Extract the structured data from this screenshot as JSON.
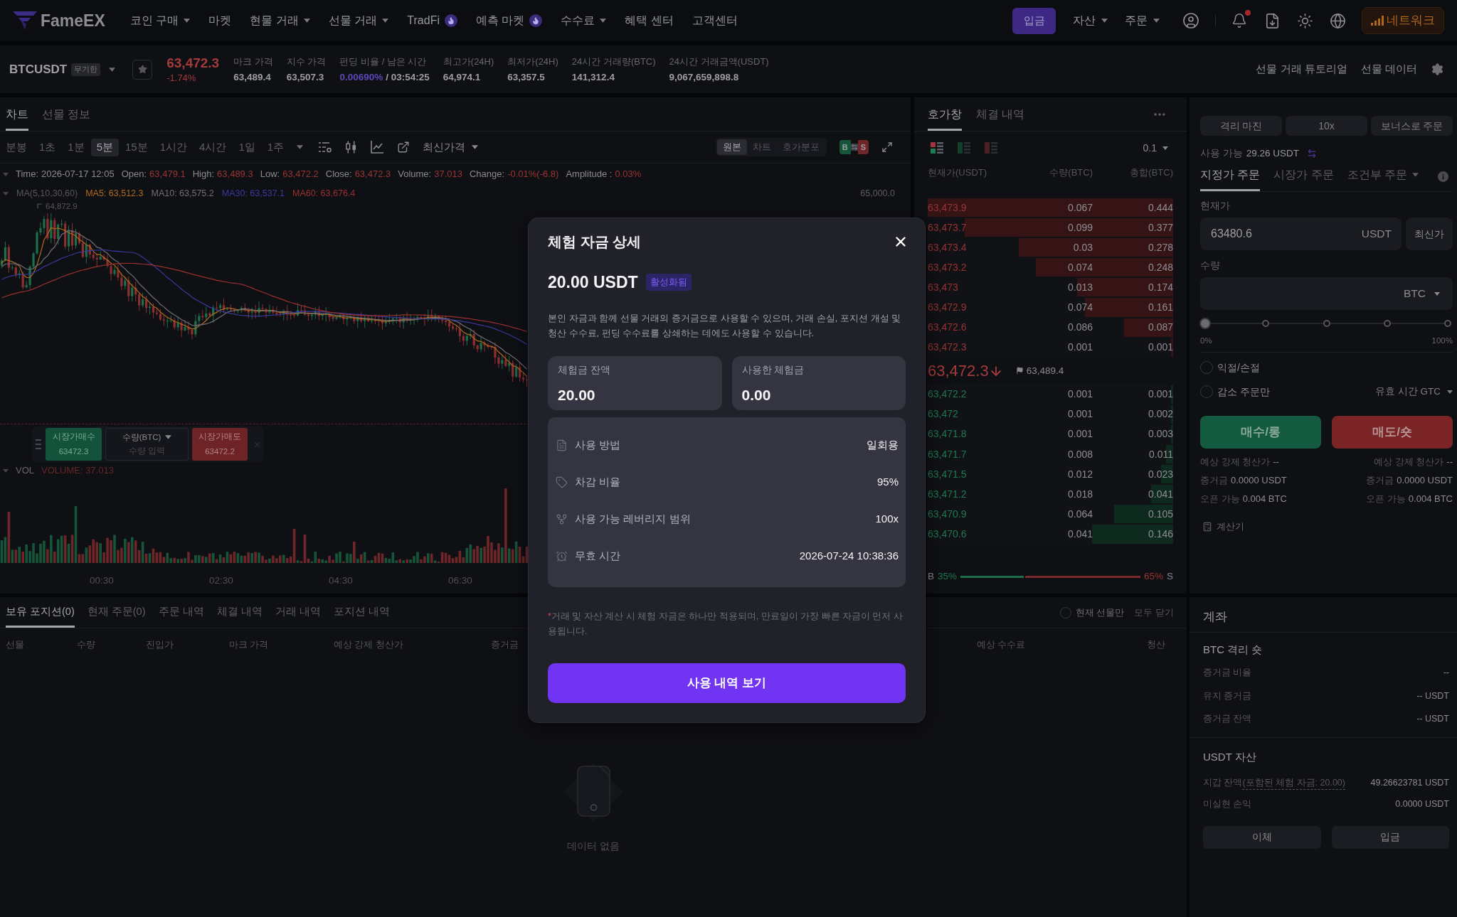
{
  "nav": {
    "logo": "FameEX",
    "items": [
      {
        "label": "코인 구매",
        "kind": "menu"
      },
      {
        "label": "마켓",
        "kind": "link"
      },
      {
        "label": "현물 거래",
        "kind": "menu"
      },
      {
        "label": "선물 거래",
        "kind": "menu"
      },
      {
        "label": "TradFi",
        "kind": "hot"
      },
      {
        "label": "예측 마켓",
        "kind": "hot"
      },
      {
        "label": "수수료",
        "kind": "menu"
      },
      {
        "label": "혜택 센터",
        "kind": "link"
      },
      {
        "label": "고객센터",
        "kind": "link"
      }
    ],
    "deposit": "입금",
    "menus": [
      {
        "label": "자산"
      },
      {
        "label": "주문"
      }
    ],
    "bell_unread": true,
    "network": "네트워크"
  },
  "ticker": {
    "symbol": "BTCUSDT",
    "badge": "무기한",
    "price": "63,472.3",
    "change": "-1.74%",
    "falling": true,
    "stats": [
      {
        "label": "마크 가격",
        "value": "63,489.4"
      },
      {
        "label": "지수 가격",
        "value": "63,507.3"
      },
      {
        "label": "펀딩 비율 / 남은 시간",
        "rate": "0.00690%",
        "value": "/ 03:54:25"
      },
      {
        "label": "최고가(24H)",
        "value": "64,974.1"
      },
      {
        "label": "최저가(24H)",
        "value": "63,357.5"
      },
      {
        "label": "24시간 거래량(BTC)",
        "value": "141,312.4"
      },
      {
        "label": "24시간 거래금액(USDT)",
        "value": "9,067,659,898.8"
      }
    ],
    "links": [
      "선물 거래 튜토리얼",
      "선물 데이터"
    ]
  },
  "chart": {
    "tabs": [
      {
        "label": "차트",
        "selected": true
      },
      {
        "label": "선물 정보",
        "selected": false
      }
    ],
    "intervals": [
      {
        "label": "분봉",
        "selected": false
      },
      {
        "label": "1초",
        "selected": false
      },
      {
        "label": "1분",
        "selected": false
      },
      {
        "label": "5분",
        "selected": true
      },
      {
        "label": "15분",
        "selected": false
      },
      {
        "label": "1시간",
        "selected": false
      },
      {
        "label": "4시간",
        "selected": false
      },
      {
        "label": "1일",
        "selected": false
      },
      {
        "label": "1주",
        "selected": false
      }
    ],
    "price_source": "최신가격",
    "views": [
      {
        "label": "원본",
        "selected": true
      },
      {
        "label": "차트",
        "selected": false
      },
      {
        "label": "호가분포",
        "selected": false
      }
    ],
    "side_toggle": {
      "buy": "B",
      "sell": "S"
    },
    "ohlc": [
      {
        "label": "Time:",
        "value": "2026-07-17 12:05",
        "kind": "plain"
      },
      {
        "label": "Open:",
        "value": "63,479.1",
        "kind": "down"
      },
      {
        "label": "High:",
        "value": "63,489.3",
        "kind": "down"
      },
      {
        "label": "Low:",
        "value": "63,472.2",
        "kind": "down"
      },
      {
        "label": "Close:",
        "value": "63,472.3",
        "kind": "down"
      },
      {
        "label": "Volume:",
        "value": "37.013",
        "kind": "down"
      },
      {
        "label": "Change:",
        "value": "-0.01%(-6.8)",
        "kind": "down"
      },
      {
        "label": "Amplitude :",
        "value": "0.03%",
        "kind": "down"
      }
    ],
    "ma_title": "MA(5,10,30,60)",
    "ma": [
      {
        "text": "MA5: 63,512.3",
        "color": "#b06a1e"
      },
      {
        "text": "MA10: 63,575.2",
        "color": "#6f7076"
      },
      {
        "text": "MA30: 63,537.1",
        "color": "#3a3a9e"
      },
      {
        "text": "MA60: 63,676.4",
        "color": "#983030"
      }
    ],
    "axis_price": "65,000.0",
    "high_label": "64,872.9",
    "quick_order": {
      "buy_label": "시장가매수",
      "buy_price": "63472.3",
      "qty_label": "수량(BTC)",
      "qty_placeholder": "수량 입력",
      "sell_label": "시장가매도",
      "sell_price": "63472.2"
    },
    "volume_title": "VOL",
    "volume_value": "VOLUME: 37.013",
    "time_axis": [
      "00:30",
      "02:30",
      "04:30",
      "06:30"
    ]
  },
  "order_book": {
    "tabs": [
      {
        "label": "호가창",
        "selected": true
      },
      {
        "label": "체결 내역",
        "selected": false
      }
    ],
    "views": [
      {
        "kind": "both",
        "selected": true
      },
      {
        "kind": "bids",
        "selected": false
      },
      {
        "kind": "asks",
        "selected": false
      }
    ],
    "precision": "0.1",
    "columns": [
      "현재가(USDT)",
      "수량(BTC)",
      "총합(BTC)"
    ],
    "asks": [
      {
        "price": "63,473.9",
        "qty": "0.067",
        "total": "0.444",
        "level": 1
      },
      {
        "price": "63,473.7",
        "qty": "0.099",
        "total": "0.377",
        "level": 0.85
      },
      {
        "price": "63,473.4",
        "qty": "0.03",
        "total": "0.278",
        "level": 0.63
      },
      {
        "price": "63,473.2",
        "qty": "0.074",
        "total": "0.248",
        "level": 0.56
      },
      {
        "price": "63,473",
        "qty": "0.013",
        "total": "0.174",
        "level": 0.39
      },
      {
        "price": "63,472.9",
        "qty": "0.074",
        "total": "0.161",
        "level": 0.36
      },
      {
        "price": "63,472.6",
        "qty": "0.086",
        "total": "0.087",
        "level": 0.2
      },
      {
        "price": "63,472.3",
        "qty": "0.001",
        "total": "0.001",
        "level": 0.01
      }
    ],
    "last_price": "63,472.3",
    "falling": true,
    "mark_price": "63,489.4",
    "bids": [
      {
        "price": "63,472.2",
        "qty": "0.001",
        "total": "0.001",
        "level": 0.01
      },
      {
        "price": "63,472",
        "qty": "0.001",
        "total": "0.002",
        "level": 0.01
      },
      {
        "price": "63,471.8",
        "qty": "0.001",
        "total": "0.003",
        "level": 0.01
      },
      {
        "price": "63,471.7",
        "qty": "0.008",
        "total": "0.011",
        "level": 0.03
      },
      {
        "price": "63,471.5",
        "qty": "0.012",
        "total": "0.023",
        "level": 0.05
      },
      {
        "price": "63,471.2",
        "qty": "0.018",
        "total": "0.041",
        "level": 0.09
      },
      {
        "price": "63,470.9",
        "qty": "0.064",
        "total": "0.105",
        "level": 0.24
      },
      {
        "price": "63,470.6",
        "qty": "0.041",
        "total": "0.146",
        "level": 0.33
      }
    ],
    "ratio": {
      "buy_label": "B",
      "buy_share": "35%",
      "sell_share": "65%",
      "sell_label": "S",
      "level": 0.35
    }
  },
  "order_form": {
    "mode_buttons": [
      "격리 마진",
      "10x",
      "보너스로 주문"
    ],
    "available": {
      "label": "사용 가능",
      "value": "29.26 USDT"
    },
    "tabs": [
      {
        "label": "지정가 주문",
        "selected": true,
        "kind": "tab"
      },
      {
        "label": "시장가 주문",
        "selected": false,
        "kind": "tab"
      },
      {
        "label": "조건부 주문",
        "selected": false,
        "kind": "menu"
      }
    ],
    "price_label": "현재가",
    "price_input": {
      "value": "63480.6",
      "unit": "USDT"
    },
    "latest_button": "최신가",
    "qty_label": "수량",
    "qty_input": {
      "unit": "BTC"
    },
    "slider": {
      "level": 0,
      "min_label": "0%",
      "max_label": "100%"
    },
    "options": [
      {
        "label": "익절/손절",
        "checked": false
      },
      {
        "label": "감소 주문만",
        "checked": false
      }
    ],
    "tif": "유효 시간 GTC",
    "buy_button": "매수/롱",
    "sell_button": "매도/숏",
    "info_rows": [
      {
        "buy_label": "예상 강제 청산가",
        "buy_value": "--",
        "sell_label": "예상 강제 청산가",
        "sell_value": "--"
      },
      {
        "buy_label": "증거금",
        "buy_value": "0.0000 USDT",
        "sell_label": "증거금",
        "sell_value": "0.0000 USDT"
      },
      {
        "buy_label": "오픈 가능",
        "buy_value": "0.004 BTC",
        "sell_label": "오픈 가능",
        "sell_value": "0.004 BTC"
      }
    ],
    "calculator": "계산기"
  },
  "positions": {
    "tabs": [
      {
        "label": "보유 포지션(0)",
        "selected": true
      },
      {
        "label": "현재 주문(0)",
        "selected": false
      },
      {
        "label": "주문 내역",
        "selected": false
      },
      {
        "label": "체결 내역",
        "selected": false
      },
      {
        "label": "거래 내역",
        "selected": false
      },
      {
        "label": "포지션 내역",
        "selected": false
      }
    ],
    "current_only": {
      "label": "현재 선물만",
      "checked": false
    },
    "close_all": "모두 닫기",
    "columns": [
      "선물",
      "수량",
      "진입가",
      "마크 가격",
      "예상 강제 청산가",
      "증거금",
      "예상 수수료",
      "청산"
    ],
    "empty": "데이터 없음"
  },
  "account": {
    "title": "계좌",
    "position_title": "BTC 격리 숏",
    "position_rows": [
      {
        "label": "증거금 비율",
        "value": "--"
      },
      {
        "label": "유지 증거금",
        "value": "-- USDT"
      },
      {
        "label": "증거금 잔액",
        "value": "-- USDT"
      }
    ],
    "asset_title": "USDT 자산",
    "wallet": {
      "label": "지갑 잔액",
      "note": "(포함된 체험 자금: 20.00)",
      "value": "49.26623781 USDT"
    },
    "unrealized": {
      "label": "미실현 손익",
      "value": "0.0000 USDT"
    },
    "buttons": [
      "이체",
      "입금"
    ]
  },
  "modal": {
    "title": "체험 자금 상세",
    "amount": "20.00 USDT",
    "status": "활성화됨",
    "description": "본인 자금과 함께 선물 거래의 증거금으로 사용할 수 있으며, 거래 손실, 포지션 개설 및 청산 수수료, 펀딩 수수료를 상쇄하는 데에도 사용할 수 있습니다.",
    "cards": [
      {
        "label": "체험금 잔액",
        "value": "20.00"
      },
      {
        "label": "사용한 체험금",
        "value": "0.00"
      }
    ],
    "details": [
      {
        "kind": "usage",
        "label": "사용 방법",
        "value": "일회용"
      },
      {
        "kind": "deduction",
        "label": "차감 비율",
        "value": "95%"
      },
      {
        "kind": "leverage",
        "label": "사용 가능 레버리지 범위",
        "value": "100x"
      },
      {
        "kind": "expiry",
        "label": "무효 시간",
        "value": "2026-07-24 10:38:36"
      }
    ],
    "note_mark": "*",
    "note": "거래 및 자산 계산 시 체험 자금은 하나만 적용되며, 만료일이 가장 빠른 자금이 먼저 사용됩니다.",
    "button": "사용 내역 보기"
  }
}
